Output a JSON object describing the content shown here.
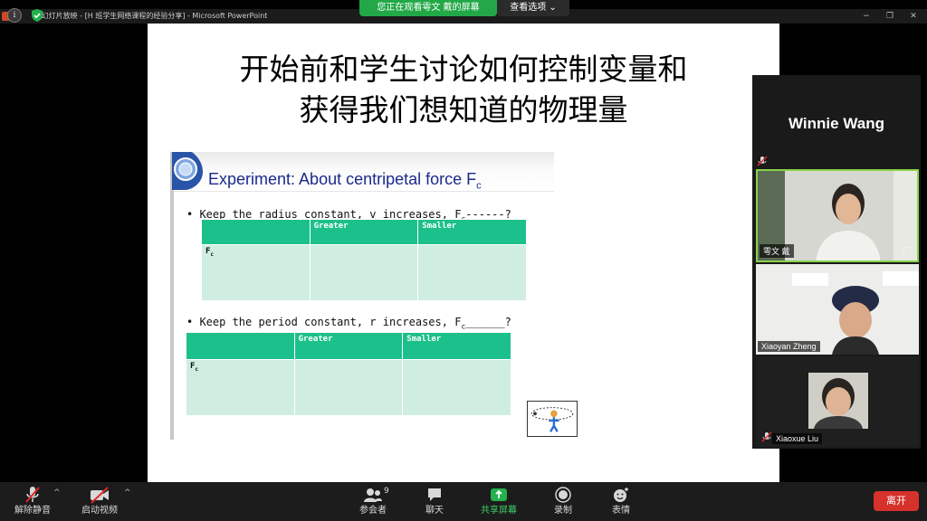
{
  "window": {
    "title": "t 幻灯片放映 - [H 班学生网络课程的经验分享] - Microsoft PowerPoint"
  },
  "zoom_top": {
    "share_banner": "您正在观看雩文 戴的屏幕",
    "view_options": "查看选项 ⌄"
  },
  "slide": {
    "title_line1": "开始前和学生讨论如何控制变量和",
    "title_line2": "获得我们想知道的物理量",
    "embedded": {
      "heading": "Experiment: About centripetal force F",
      "heading_sub": "c",
      "bullet1_pre": "• Keep the radius constant, v increases, F",
      "bullet1_sub": "c",
      "bullet1_post": "------?",
      "bullet2_pre": "• Keep the period constant, r increases, F",
      "bullet2_sub": "c",
      "bullet2_post": "______?",
      "table1": {
        "headers": [
          "",
          "Greater",
          "Smaller"
        ],
        "row_label": "F",
        "row_label_sub": "c"
      },
      "table2": {
        "headers": [
          "",
          "Greater",
          "Smaller"
        ],
        "row_label": "F",
        "row_label_sub": "c"
      }
    }
  },
  "panel": {
    "active_speaker": "Winnie Wang",
    "tiles": [
      {
        "name": "雩文 戴"
      },
      {
        "name": "Xiaoyan Zheng"
      },
      {
        "name": "Xiaoxue Liu"
      }
    ]
  },
  "toolbar": {
    "unmute": "解除静音",
    "start_video": "启动视频",
    "participants": "参会者",
    "participants_count": "9",
    "chat": "聊天",
    "share_screen": "共享屏幕",
    "record": "录制",
    "reactions": "表情",
    "leave": "离开"
  },
  "colors": {
    "share_green": "#22a847",
    "table_header": "#1cc08a",
    "table_body": "#cfeee1",
    "leave_red": "#d6322c",
    "heading_blue": "#1a2a8c"
  }
}
